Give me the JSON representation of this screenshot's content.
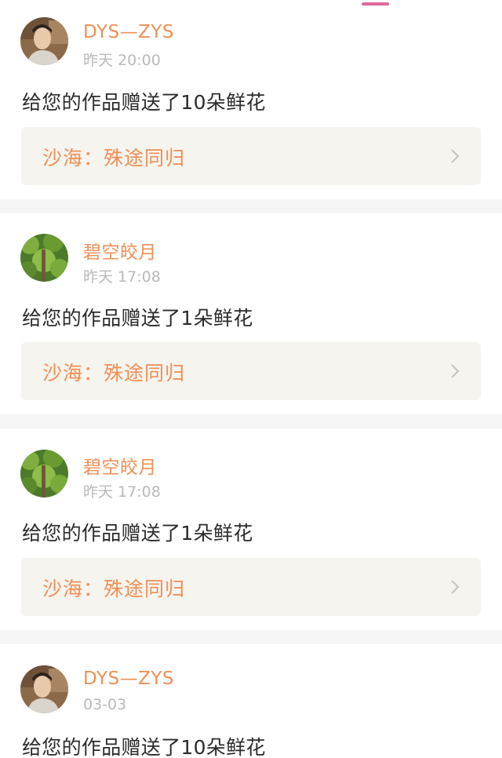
{
  "tab_indicator_color": "#e0679a",
  "accent_color": "#ef8f55",
  "notifications": [
    {
      "avatar_icon": "user-photo-man",
      "username": "DYS—ZYS",
      "time": "昨天 20:00",
      "message": "给您的作品赠送了10朵鲜花",
      "work_title": "沙海：殊途同归"
    },
    {
      "avatar_icon": "user-photo-green-plants",
      "username": "碧空皎月",
      "time": "昨天 17:08",
      "message": "给您的作品赠送了1朵鲜花",
      "work_title": "沙海：殊途同归"
    },
    {
      "avatar_icon": "user-photo-green-plants",
      "username": "碧空皎月",
      "time": "昨天 17:08",
      "message": "给您的作品赠送了1朵鲜花",
      "work_title": "沙海：殊途同归"
    },
    {
      "avatar_icon": "user-photo-man",
      "username": "DYS—ZYS",
      "time": "03-03",
      "message": "给您的作品赠送了10朵鲜花"
    }
  ]
}
